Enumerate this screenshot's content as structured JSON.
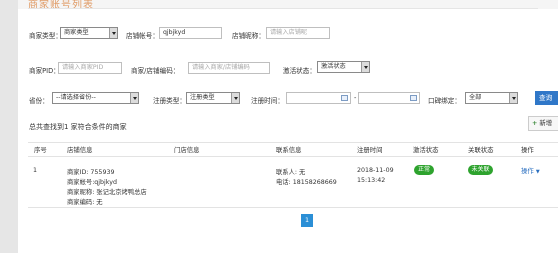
{
  "page": {
    "title": "商家账号列表"
  },
  "filters": {
    "merchant_type": {
      "label": "商家类型：",
      "value": "商家类型"
    },
    "shop_account": {
      "label": "店铺帐号：",
      "value": "qjbjkyd"
    },
    "shop_name": {
      "label": "店铺昵称：",
      "placeholder": "请输入店铺昵"
    },
    "merchant_pid": {
      "label": "商家PID：",
      "placeholder": "请输入商家PID"
    },
    "shop_code": {
      "label": "商家/店铺编码：",
      "placeholder": "请输入商家/店铺编码"
    },
    "activation": {
      "label": "激活状态：",
      "value": "激活状态"
    },
    "province": {
      "label": "省份：",
      "value": "--请选择省份--"
    },
    "register_type": {
      "label": "注册类型：",
      "value": "注册类型"
    },
    "register_time": {
      "label": "注册时间：",
      "separator": "-"
    },
    "password_bind": {
      "label": "口碑绑定：",
      "value": "全部"
    },
    "query_button": "查询",
    "add_button": "新增"
  },
  "result": {
    "summary": "总共查找到1 家符合条件的商家",
    "columns": [
      "序号",
      "店铺信息",
      "门店信息",
      "联系信息",
      "注册时间",
      "激活状态",
      "关联状态",
      "操作"
    ],
    "rows": [
      {
        "index": "1",
        "shop_info": [
          "商家ID: 755939",
          "商家帐号:qjbjkyd",
          "商家昵称: 张记北京烤鸭总店",
          "商家编码: 无"
        ],
        "store_info": "",
        "contact": [
          "联系人: 无",
          "电话: 18158268669"
        ],
        "register_date": "2018-11-09",
        "register_time": "15:13:42",
        "activation_status": "正常",
        "link_status": "未关联",
        "action": "操作"
      }
    ]
  },
  "pagination": {
    "current": "1"
  },
  "colors": {
    "accent": "#2f77c8",
    "badge_green": "#2ea32e",
    "title_orange": "#e09b66",
    "page_blue": "#2b8fd6"
  }
}
